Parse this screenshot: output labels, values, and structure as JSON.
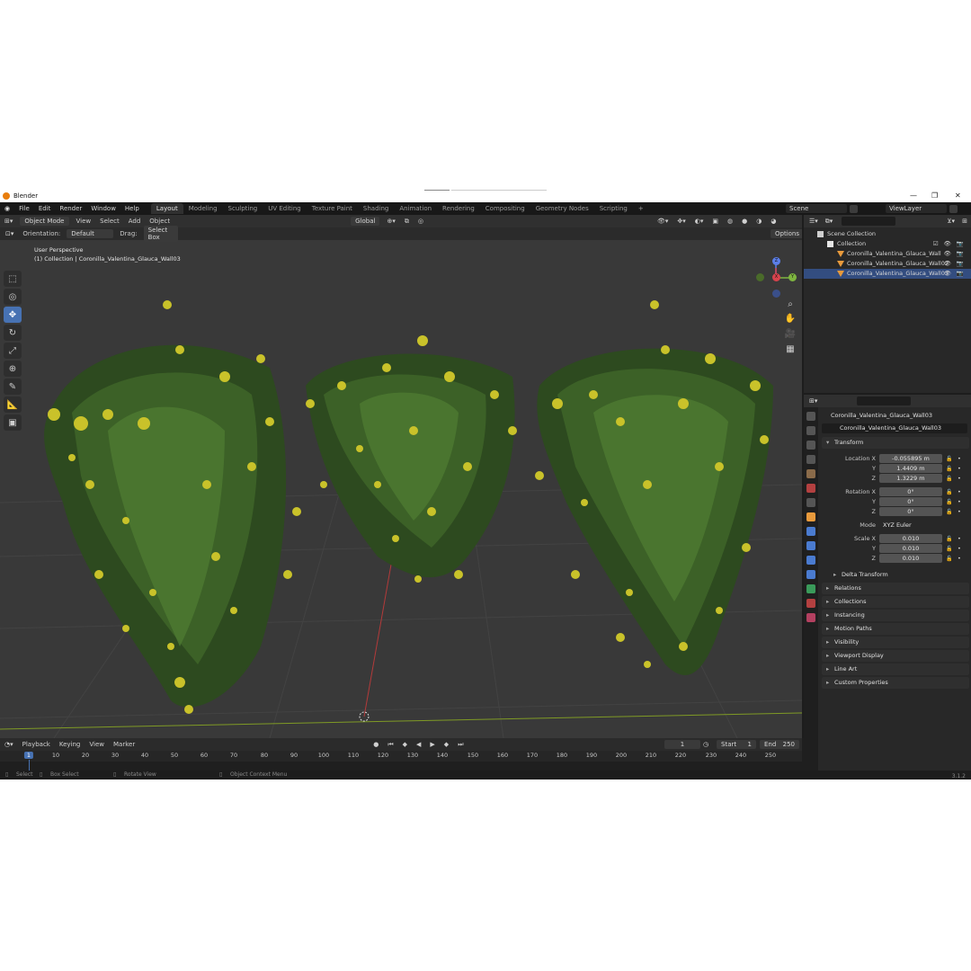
{
  "window": {
    "app_title": "Blender",
    "minimize": "—",
    "maximize": "❐",
    "close": "✕"
  },
  "menu": [
    "File",
    "Edit",
    "Render",
    "Window",
    "Help"
  ],
  "workspace_tabs": [
    "Layout",
    "Modeling",
    "Sculpting",
    "UV Editing",
    "Texture Paint",
    "Shading",
    "Animation",
    "Rendering",
    "Compositing",
    "Geometry Nodes",
    "Scripting"
  ],
  "active_tab": "Layout",
  "scene": {
    "name": "Scene",
    "view_layer": "ViewLayer"
  },
  "viewport_header": {
    "mode": "Object Mode",
    "items": [
      "View",
      "Select",
      "Add",
      "Object"
    ],
    "transform_orientation": "Global"
  },
  "tool_settings": {
    "orientation_label": "Orientation:",
    "orientation_value": "Default",
    "drag_label": "Drag:",
    "drag_value": "Select Box",
    "options": "Options"
  },
  "viewport_overlay": {
    "perspective": "User Perspective",
    "collection_info": "(1) Collection | Coronilla_Valentina_Glauca_Wall03"
  },
  "gizmo": {
    "z": "Z",
    "y": "Y",
    "x": "X"
  },
  "outliner": {
    "scene_collection": "Scene Collection",
    "collection": "Collection",
    "objects": [
      "Coronilla_Valentina_Glauca_Wall",
      "Coronilla_Valentina_Glauca_Wall02",
      "Coronilla_Valentina_Glauca_Wall03"
    ]
  },
  "properties": {
    "object_name": "Coronilla_Valentina_Glauca_Wall03",
    "object_field": "Coronilla_Valentina_Glauca_Wall03",
    "transform_title": "Transform",
    "location": {
      "label": "Location X",
      "x": "-0.055895 m",
      "y": "1.4409 m",
      "z": "1.3229 m"
    },
    "rotation": {
      "label": "Rotation X",
      "x": "0°",
      "y": "0°",
      "z": "0°"
    },
    "mode_label": "Mode",
    "mode_value": "XYZ Euler",
    "scale": {
      "label": "Scale X",
      "x": "0.010",
      "y": "0.010",
      "z": "0.010"
    },
    "axis_y": "Y",
    "axis_z": "Z",
    "delta_transform": "Delta Transform",
    "panels": [
      "Relations",
      "Collections",
      "Instancing",
      "Motion Paths",
      "Visibility",
      "Viewport Display",
      "Line Art",
      "Custom Properties"
    ]
  },
  "timeline": {
    "menu": [
      "Playback",
      "Keying",
      "View",
      "Marker"
    ],
    "current_frame": "1",
    "start_label": "Start",
    "start": "1",
    "end_label": "End",
    "end": "250",
    "ticks": [
      "1",
      "10",
      "20",
      "30",
      "40",
      "50",
      "60",
      "70",
      "80",
      "90",
      "100",
      "110",
      "120",
      "130",
      "140",
      "150",
      "160",
      "170",
      "180",
      "190",
      "200",
      "210",
      "220",
      "230",
      "240",
      "250"
    ]
  },
  "status_bar": {
    "select": "Select",
    "box_select": "Box Select",
    "rotate_view": "Rotate View",
    "context_menu": "Object Context Menu",
    "version": "3.1.2"
  }
}
